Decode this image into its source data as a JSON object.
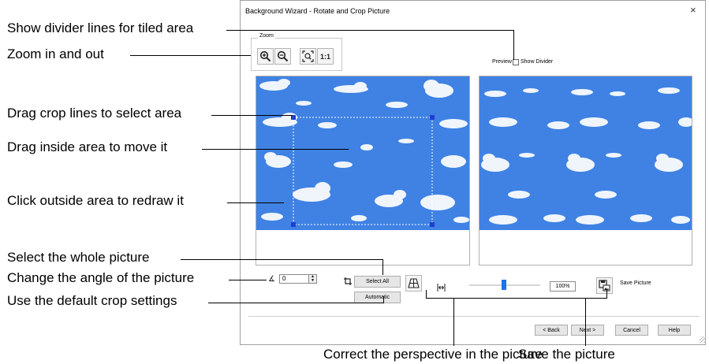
{
  "dialog": {
    "title": "Background Wizard - Rotate and Crop Picture",
    "close_glyph": "×",
    "zoom_group_label": "Zoom",
    "zoom_one_to_one_label": "1:1",
    "preview_label": "Preview",
    "show_divider_label": "Show Divider",
    "show_divider_checked": false,
    "angle_value": "0",
    "select_all_label": "Select All",
    "automatic_label": "Automatic",
    "zoom_percent": "100%",
    "zoom_slider_fraction": 0.49,
    "save_picture_label": "Save Picture",
    "buttons": {
      "back": "< Back",
      "next": "Next >",
      "cancel": "Cancel",
      "help": "Help"
    },
    "colors": {
      "sky": "#3f82e4",
      "crop_handle": "#1f3fd0"
    },
    "icons": [
      "zoom-in-icon",
      "zoom-out-icon",
      "zoom-fit-icon",
      "angle-icon",
      "crop-icon",
      "perspective-icon",
      "fit-width-icon",
      "save-picture-icon"
    ]
  },
  "annotations": {
    "show_divider": "Show divider lines for tiled area",
    "zoom": "Zoom in and out",
    "crop_lines": "Drag crop lines to select area",
    "drag_inside": "Drag inside area to move it",
    "click_outside": "Click outside area to redraw it",
    "select_whole": "Select the whole picture",
    "change_angle": "Change the angle of the picture",
    "default_crop": "Use the default crop settings",
    "perspective": "Correct the perspective in the picture",
    "save_picture": "Save the picture"
  }
}
